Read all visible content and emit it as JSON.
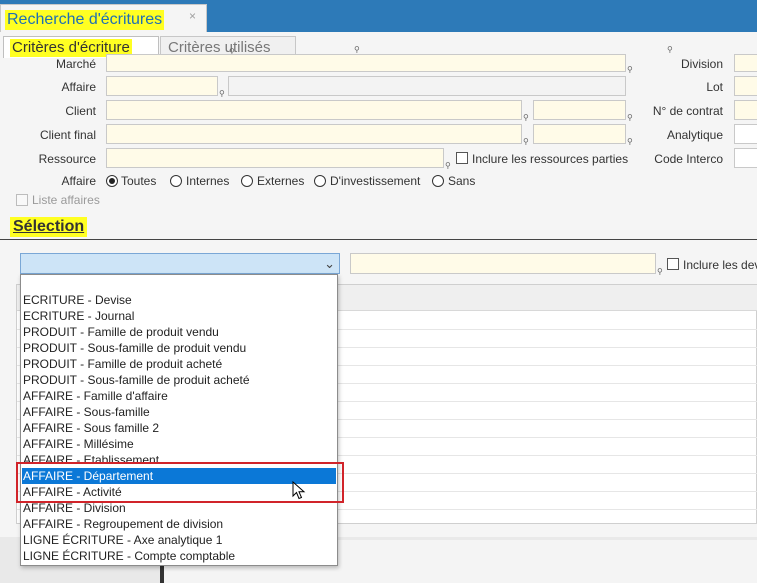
{
  "window_tab": {
    "title": "Recherche d'écritures",
    "close": "×"
  },
  "tabs": [
    {
      "label": "Critères d'écriture"
    },
    {
      "label": "Critères utilisés"
    }
  ],
  "form": {
    "marche_label": "Marché",
    "affaire_label": "Affaire",
    "client_label": "Client",
    "client_final_label": "Client final",
    "ressource_label": "Ressource",
    "inclure_ressources": "Inclure les ressources parties",
    "affaire_type_label": "Affaire",
    "radio_options": [
      "Toutes",
      "Internes",
      "Externes",
      "D'investissement",
      "Sans"
    ],
    "liste_affaires": "Liste affaires",
    "division_label": "Division",
    "lot_label": "Lot",
    "contrat_label": "N° de contrat",
    "analytique_label": "Analytique",
    "code_interco_label": "Code Interco"
  },
  "selection": {
    "title": "Sélection",
    "inclure_devises": "Inclure les dev",
    "combo_value": ""
  },
  "dropdown": {
    "items": [
      "ECRITURE - Devise",
      "ECRITURE - Journal",
      "PRODUIT - Famille de produit vendu",
      "PRODUIT - Sous-famille de produit vendu",
      "PRODUIT - Famille de produit acheté",
      "PRODUIT - Sous-famille de produit acheté",
      "AFFAIRE - Famille d'affaire",
      "AFFAIRE - Sous-famille",
      "AFFAIRE - Sous famille 2",
      "AFFAIRE - Millésime",
      "AFFAIRE - Etablissement",
      "AFFAIRE - Département",
      "AFFAIRE - Activité",
      "AFFAIRE - Division",
      "AFFAIRE - Regroupement de division",
      "LIGNE ÉCRITURE - Axe analytique 1",
      "LIGNE ÉCRITURE - Compte comptable"
    ],
    "selected": "AFFAIRE - Département"
  },
  "colors": {
    "accent_blue": "#2d7ab8",
    "highlight_yellow": "#ffff22",
    "selection_blue": "#0b78d7",
    "annotation_red": "#d1242a"
  }
}
